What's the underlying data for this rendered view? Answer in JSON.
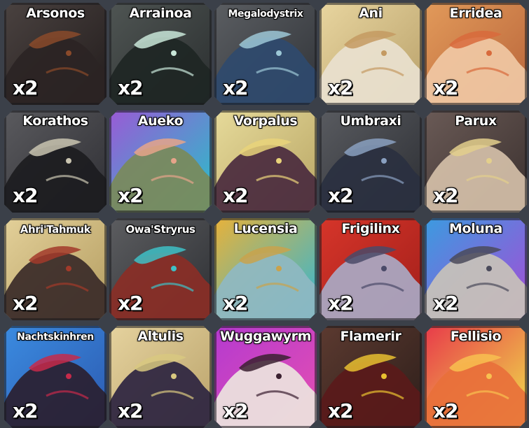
{
  "inventory": {
    "items": [
      {
        "name": "Arsonos",
        "count": "x2",
        "bg": [
          "#4a4240",
          "#221c1c"
        ],
        "creature": "#2b2424",
        "accent": "#8a4a2a"
      },
      {
        "name": "Arrainoa",
        "count": "x2",
        "bg": [
          "#4f5553",
          "#2a2e2f"
        ],
        "creature": "#1e2624",
        "accent": "#c8e6d8"
      },
      {
        "name": "Megalodystrix",
        "count": "x2",
        "bg": [
          "#5b5e62",
          "#303338"
        ],
        "creature": "#2f4a6e",
        "accent": "#9cc7d6"
      },
      {
        "name": "Ani",
        "count": "x2",
        "bg": [
          "#e8d59f",
          "#b8a06a"
        ],
        "creature": "#e9e1cf",
        "accent": "#c49a62"
      },
      {
        "name": "Erridea",
        "count": "x2",
        "bg": [
          "#e29a5a",
          "#b8643a"
        ],
        "creature": "#f0c8a4",
        "accent": "#d86a3c"
      },
      {
        "name": "Korathos",
        "count": "x2",
        "bg": [
          "#5a5a5e",
          "#2e2e33"
        ],
        "creature": "#1c1c20",
        "accent": "#c9c4b0"
      },
      {
        "name": "Aueko",
        "count": "x2",
        "bg": [
          "#9a5ad6",
          "#25c2c8"
        ],
        "creature": "#7a8a5a",
        "accent": "#e6a48a"
      },
      {
        "name": "Vorpalus",
        "count": "x2",
        "bg": [
          "#e6da9a",
          "#b8a564"
        ],
        "creature": "#4a2a3e",
        "accent": "#e9d37a"
      },
      {
        "name": "Umbraxi",
        "count": "x2",
        "bg": [
          "#595b60",
          "#2c2e33"
        ],
        "creature": "#2a3040",
        "accent": "#8aa0c0"
      },
      {
        "name": "Parux",
        "count": "x2",
        "bg": [
          "#6a5a56",
          "#3a302e"
        ],
        "creature": "#d4bfa8",
        "accent": "#e3cf8c"
      },
      {
        "name": "Ahri'Tahmuk",
        "count": "x2",
        "bg": [
          "#e3d099",
          "#b39c60"
        ],
        "creature": "#3a2a28",
        "accent": "#a23a2a"
      },
      {
        "name": "Owa'Stryrus",
        "count": "x2",
        "bg": [
          "#5c5d60",
          "#2d2f33"
        ],
        "creature": "#8a2e26",
        "accent": "#3ec0c6"
      },
      {
        "name": "Lucensia",
        "count": "x2",
        "bg": [
          "#e8b23a",
          "#2fb6d6"
        ],
        "creature": "#8fb8c2",
        "accent": "#c9a24c"
      },
      {
        "name": "Frigilinx",
        "count": "x2",
        "bg": [
          "#d6352a",
          "#a21f1a"
        ],
        "creature": "#a9a9c4",
        "accent": "#4a4a68"
      },
      {
        "name": "Moluna",
        "count": "x2",
        "bg": [
          "#3b9be0",
          "#a84ad6"
        ],
        "creature": "#c8c2b8",
        "accent": "#4a4a5a"
      },
      {
        "name": "Nachtskinhren",
        "count": "x2",
        "bg": [
          "#3b8be0",
          "#2c5ab0"
        ],
        "creature": "#2a2030",
        "accent": "#c62a4a"
      },
      {
        "name": "Altulis",
        "count": "x2",
        "bg": [
          "#e5d29e",
          "#b9a26a"
        ],
        "creature": "#2c2440",
        "accent": "#d8c880"
      },
      {
        "name": "Wuggawyrm",
        "count": "x2",
        "bg": [
          "#b43ad0",
          "#e64fb0"
        ],
        "creature": "#ece4de",
        "accent": "#3a2030"
      },
      {
        "name": "Flamerir",
        "count": "x2",
        "bg": [
          "#5c3a30",
          "#2c1e1a"
        ],
        "creature": "#5a1a1a",
        "accent": "#e8c030"
      },
      {
        "name": "Fellisio",
        "count": "x2",
        "bg": [
          "#e83a4a",
          "#f0e24a"
        ],
        "creature": "#e8703a",
        "accent": "#f8c050"
      }
    ]
  }
}
